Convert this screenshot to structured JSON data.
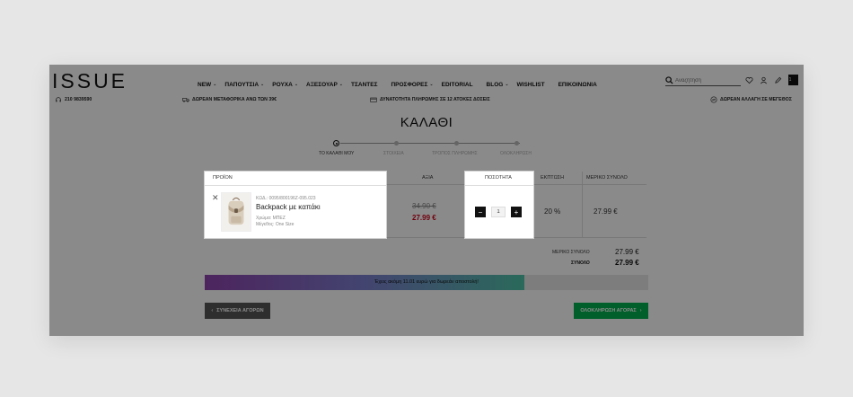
{
  "brand": {
    "logo": "ISSUE"
  },
  "nav": [
    {
      "label": "NEW",
      "chevron": true
    },
    {
      "label": "ΠΑΠΟΥΤΣΙΑ",
      "chevron": true
    },
    {
      "label": "ΡΟΥΧΑ",
      "chevron": true
    },
    {
      "label": "ΑΞΕΣΟΥΑΡ",
      "chevron": true
    },
    {
      "label": "ΤΣΑΝΤΕΣ",
      "chevron": false
    },
    {
      "label": "ΠΡΟΣΦΟΡΕΣ",
      "chevron": true
    },
    {
      "label": "EDITORIAL",
      "chevron": false
    },
    {
      "label": "BLOG",
      "chevron": true
    },
    {
      "label": "WISHLIST",
      "chevron": false
    },
    {
      "label": "ΕΠΙΚΟΙΝΩΝΙΑ",
      "chevron": false
    }
  ],
  "search": {
    "placeholder": "Αναζήτηση"
  },
  "header_icons": [
    "heart-icon",
    "user-icon",
    "pencil-icon",
    "cart-icon"
  ],
  "cart_count": "1",
  "infobar": {
    "phone": "210 9839590",
    "shipping": "ΔΩΡΕΑΝ ΜΕΤΑΦΟΡΙΚΑ ΑΝΩ ΤΩΝ 39€",
    "installments": "ΔΥΝΑΤΟΤΗΤΑ ΠΛΗΡΩΜΗΣ ΣΕ 12 ΑΤΟΚΕΣ ΔΟΣΕΙΣ",
    "exchange": "ΔΩΡΕΑΝ ΑΛΛΑΓΗ ΣΕ ΜΕΓΕΘΟΣ"
  },
  "page_title": "ΚΑΛΑΘΙ",
  "steps": [
    {
      "label": "ΤΟ ΚΑΛΑΘΙ ΜΟΥ",
      "active": true
    },
    {
      "label": "ΣΤΟΙΧΕΙΑ",
      "active": false
    },
    {
      "label": "ΤΡΟΠΟΣ ΠΛΗΡΩΜΗΣ",
      "active": false
    },
    {
      "label": "ΟΛΟΚΛΗΡΩΣΗ",
      "active": false
    }
  ],
  "table": {
    "headers": {
      "product": "ΠΡΟΪΟΝ",
      "price": "ΑΞΙΑ",
      "quantity": "ΠΟΣΟΤΗΤΑ",
      "discount": "ΕΚΠΤΩΣΗ",
      "line_total": "ΜΕΡΙΚΟ ΣΥΝΟΛΟ"
    },
    "row": {
      "code": "ΚΩΔ.: 0095/800196Z-095.023",
      "name": "Backpack με καπάκι",
      "color": "Χρώμα: ΜΠΕΖ",
      "size": "Μέγεθος: One Size",
      "old_price": "34.90 €",
      "new_price": "27.99 €",
      "quantity": "1",
      "discount": "20 %",
      "line_total": "27.99 €"
    }
  },
  "totals": {
    "subtotal_label": "ΜΕΡΙΚΟ ΣΥΝΟΛΟ",
    "subtotal_value": "27.99 €",
    "total_label": "ΣΥΝΟΛΟ",
    "total_value": "27.99 €"
  },
  "free_shipping": {
    "message": "Έχεις ακόμη 11.01 ευρώ για δωρεάν αποστολή!",
    "progress": 0.72
  },
  "buttons": {
    "continue": "ΣΥΝΕΧΕΙΑ ΑΓΟΡΩΝ",
    "checkout": "ΟΛΟΚΛΗΡΩΣΗ ΑΓΟΡΑΣ"
  },
  "colors": {
    "accent_green": "#00b04f",
    "sale_red": "#d0021b"
  }
}
